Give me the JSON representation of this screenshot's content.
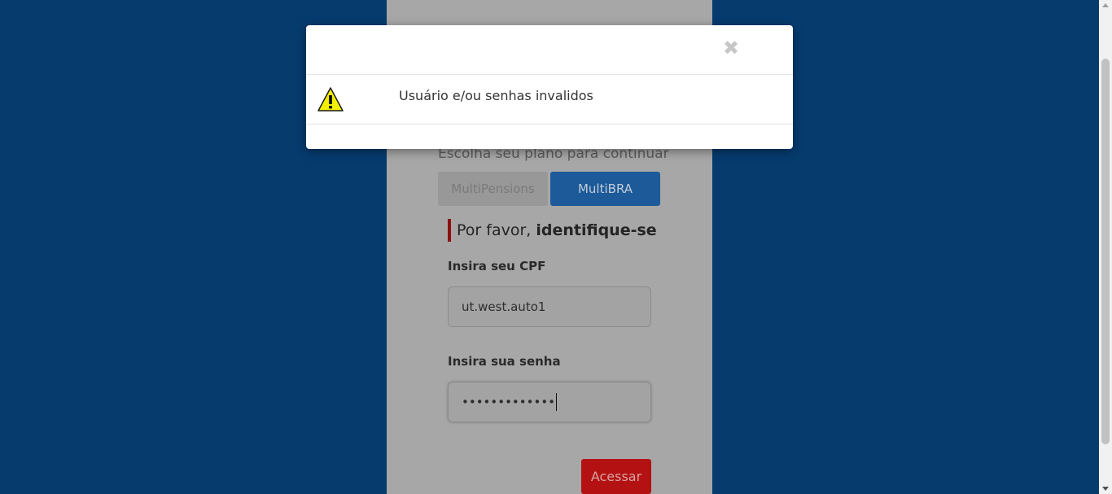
{
  "login": {
    "choose_plan_text": "Escolha seu plano para continuar",
    "plans": [
      "MultiPensions",
      "MultiBRA"
    ],
    "identify_prefix": "Por favor, ",
    "identify_bold": "identifique-se",
    "cpf_label": "Insira seu CPF",
    "cpf_value": "ut.west.auto1",
    "password_label": "Insira sua senha",
    "password_value": "•••••••••••••",
    "access_button": "Acessar"
  },
  "modal": {
    "close_glyph": "✖",
    "message": "Usuário e/ou senhas invalidos",
    "icon": "warning-icon"
  },
  "colors": {
    "page_bg": "#063b6e",
    "accent_blue": "#1c5a9a",
    "accent_red": "#b41212"
  }
}
